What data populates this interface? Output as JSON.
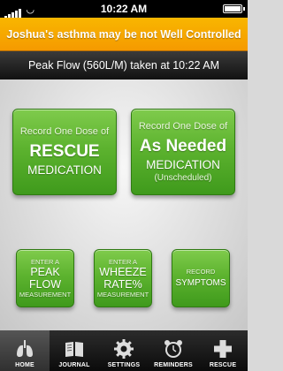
{
  "status_bar": {
    "time": "10:22 AM"
  },
  "alert": {
    "text": "Joshua's asthma may be not Well Controlled"
  },
  "reading": {
    "text": "Peak Flow (560L/M) taken at 10:22 AM"
  },
  "buttons": {
    "rescue": {
      "line1": "Record One Dose of",
      "line2": "RESCUE",
      "line3": "MEDICATION"
    },
    "as_needed": {
      "line1": "Record One Dose of",
      "line2": "As Needed",
      "line3": "MEDICATION",
      "line4": "(Unscheduled)"
    },
    "peak_flow": {
      "top": "ENTER A",
      "main": "PEAK FLOW",
      "bottom": "MEASUREMENT"
    },
    "wheeze": {
      "top": "ENTER A",
      "main": "WHEEZE RATE%",
      "bottom": "MEASUREMENT"
    },
    "symptoms": {
      "top": "RECORD",
      "main": "SYMPTOMS"
    }
  },
  "tabs": [
    {
      "label": "HOME",
      "icon": "lungs-icon",
      "active": true
    },
    {
      "label": "JOURNAL",
      "icon": "book-icon",
      "active": false
    },
    {
      "label": "SETTINGS",
      "icon": "gear-icon",
      "active": false
    },
    {
      "label": "REMINDERS",
      "icon": "alarm-clock-icon",
      "active": false
    },
    {
      "label": "RESCUE",
      "icon": "plus-icon",
      "active": false
    }
  ],
  "colors": {
    "alert_bg": "#f59a00",
    "button_green": "#5db32f",
    "tabbar_bg": "#111111"
  }
}
